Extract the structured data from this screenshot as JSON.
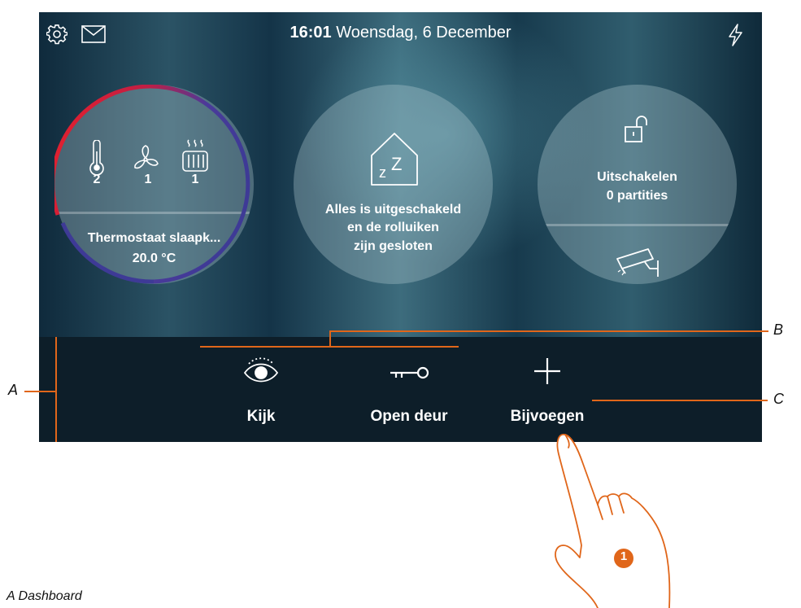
{
  "header": {
    "time": "16:01",
    "date": "Woensdag, 6 December",
    "icons": {
      "settings": "gear-icon",
      "messages": "envelope-icon",
      "power": "lightning-icon"
    }
  },
  "thermostat": {
    "counts": [
      "2",
      "1",
      "1"
    ],
    "icons": [
      "thermometer-icon",
      "fan-icon",
      "radiator-icon"
    ],
    "name": "Thermostaat slaapk...",
    "temperature": "20.0 °C",
    "colors": {
      "heat": "#e8202a",
      "cool": "#4a3a9a"
    }
  },
  "scenario": {
    "icon": "house-sleep-icon",
    "line1": "Alles is uitgeschakeld",
    "line2": "en de rolluiken",
    "line3": "zijn gesloten"
  },
  "alarm": {
    "icon": "unlocked-padlock-icon",
    "status": "Uitschakelen",
    "partitions": "0 partities",
    "camera_icon": "security-camera-icon"
  },
  "bottombar": {
    "items": [
      {
        "label": "Kijk",
        "icon": "eye-icon"
      },
      {
        "label": "Open deur",
        "icon": "key-icon"
      },
      {
        "label": "Bijvoegen",
        "icon": "plus-icon"
      }
    ]
  },
  "annotations": {
    "a": "A",
    "b": "B",
    "c": "C",
    "step": "1",
    "caption": "A   Dashboard"
  },
  "colors": {
    "accent": "#e0661a",
    "bottombar": "#0d1e29"
  }
}
